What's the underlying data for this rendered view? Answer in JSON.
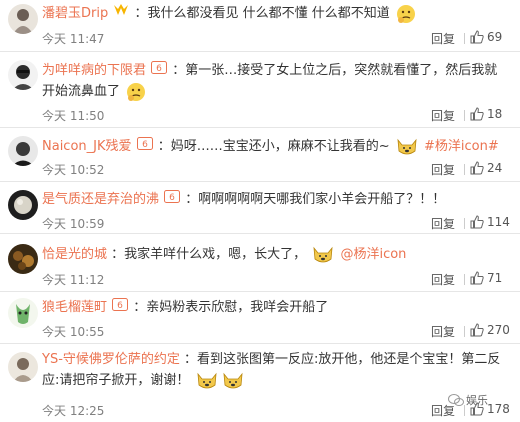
{
  "comments": [
    {
      "user": "潘碧玉Drip",
      "text": "：我什么都没看见 什么都不懂 什么都不知道",
      "time": "今天 11:47",
      "reply": "回复",
      "likes": "69"
    },
    {
      "user": "为咩咩病的下限君",
      "text": "：第一张…接受了女上位之后，突然就看懂了，然后我就开始流鼻血了",
      "time": "今天 11:50",
      "reply": "回复",
      "likes": "18"
    },
    {
      "user": "Naicon_JK残爱",
      "text": "：妈呀……宝宝还小，麻麻不让我看的~",
      "link": "#杨洋icon#",
      "time": "今天 10:52",
      "reply": "回复",
      "likes": "24"
    },
    {
      "user": "是气质还是弃治的沸",
      "text": "：啊啊啊啊啊天哪我们家小羊会开船了？！！",
      "time": "今天 10:59",
      "reply": "回复",
      "likes": "114"
    },
    {
      "user": "恰是光的城",
      "text": "：我家羊咩什么戏，嗯，长大了，",
      "link": "@杨洋icon",
      "time": "今天 11:12",
      "reply": "回复",
      "likes": "71"
    },
    {
      "user": "狼毛榴莲町",
      "text": "：亲妈粉表示欣慰，我咩会开船了",
      "time": "今天 10:55",
      "reply": "回复",
      "likes": "270"
    },
    {
      "user": "YS-守候佛罗伦萨的约定",
      "text": "：看到这张图第一反应:放开他，他还是个宝宝！第二反应:请把帘子掀开，谢谢！",
      "time": "今天 12:25",
      "reply": "回复",
      "likes": "178"
    }
  ],
  "watermark": "娱乐",
  "colors": {
    "username": "#eb7350",
    "meta": "#808080",
    "vip": "#f7b500",
    "link": "#eb7350"
  },
  "icons": {
    "thumb": "thumbs-up-icon",
    "vip": "crown-v-badge-icon",
    "member": "member-badge-icon",
    "emoji": "thinking-face-icon",
    "dog": "doge-icon"
  }
}
